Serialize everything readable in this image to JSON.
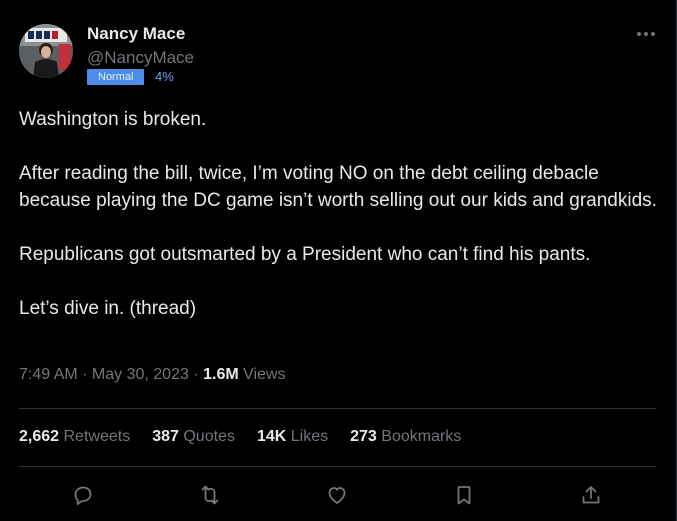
{
  "author": {
    "name": "Nancy Mace",
    "handle": "@NancyMace",
    "badge": "Normal",
    "percent": "4%"
  },
  "tweet": {
    "paragraphs": [
      "Washington is broken.",
      "After reading the bill, twice, I’m voting NO on the debt ceiling debacle because playing the DC game isn’t worth selling out our kids and grandkids.",
      "Republicans got outsmarted by a President who can’t find his pants.",
      "Let’s dive in.  (thread)"
    ],
    "time": "7:49 AM",
    "date": "May 30, 2023",
    "views_count": "1.6M",
    "views_label": "Views"
  },
  "stats": {
    "retweets_count": "2,662",
    "retweets_label": "Retweets",
    "quotes_count": "387",
    "quotes_label": "Quotes",
    "likes_count": "14K",
    "likes_label": "Likes",
    "bookmarks_count": "273",
    "bookmarks_label": "Bookmarks"
  },
  "icons": {
    "more": "more-horizontal-icon",
    "reply": "reply-bubble-icon",
    "retweet": "retweet-icon",
    "like": "heart-icon",
    "bookmark": "bookmark-icon",
    "share": "share-upload-icon"
  },
  "colors": {
    "background": "#000000",
    "text_primary": "#e7e9ea",
    "text_secondary": "#71767b",
    "divider": "#2f3336",
    "badge_bg": "#4c8de8",
    "percent": "#6f9ff0"
  }
}
